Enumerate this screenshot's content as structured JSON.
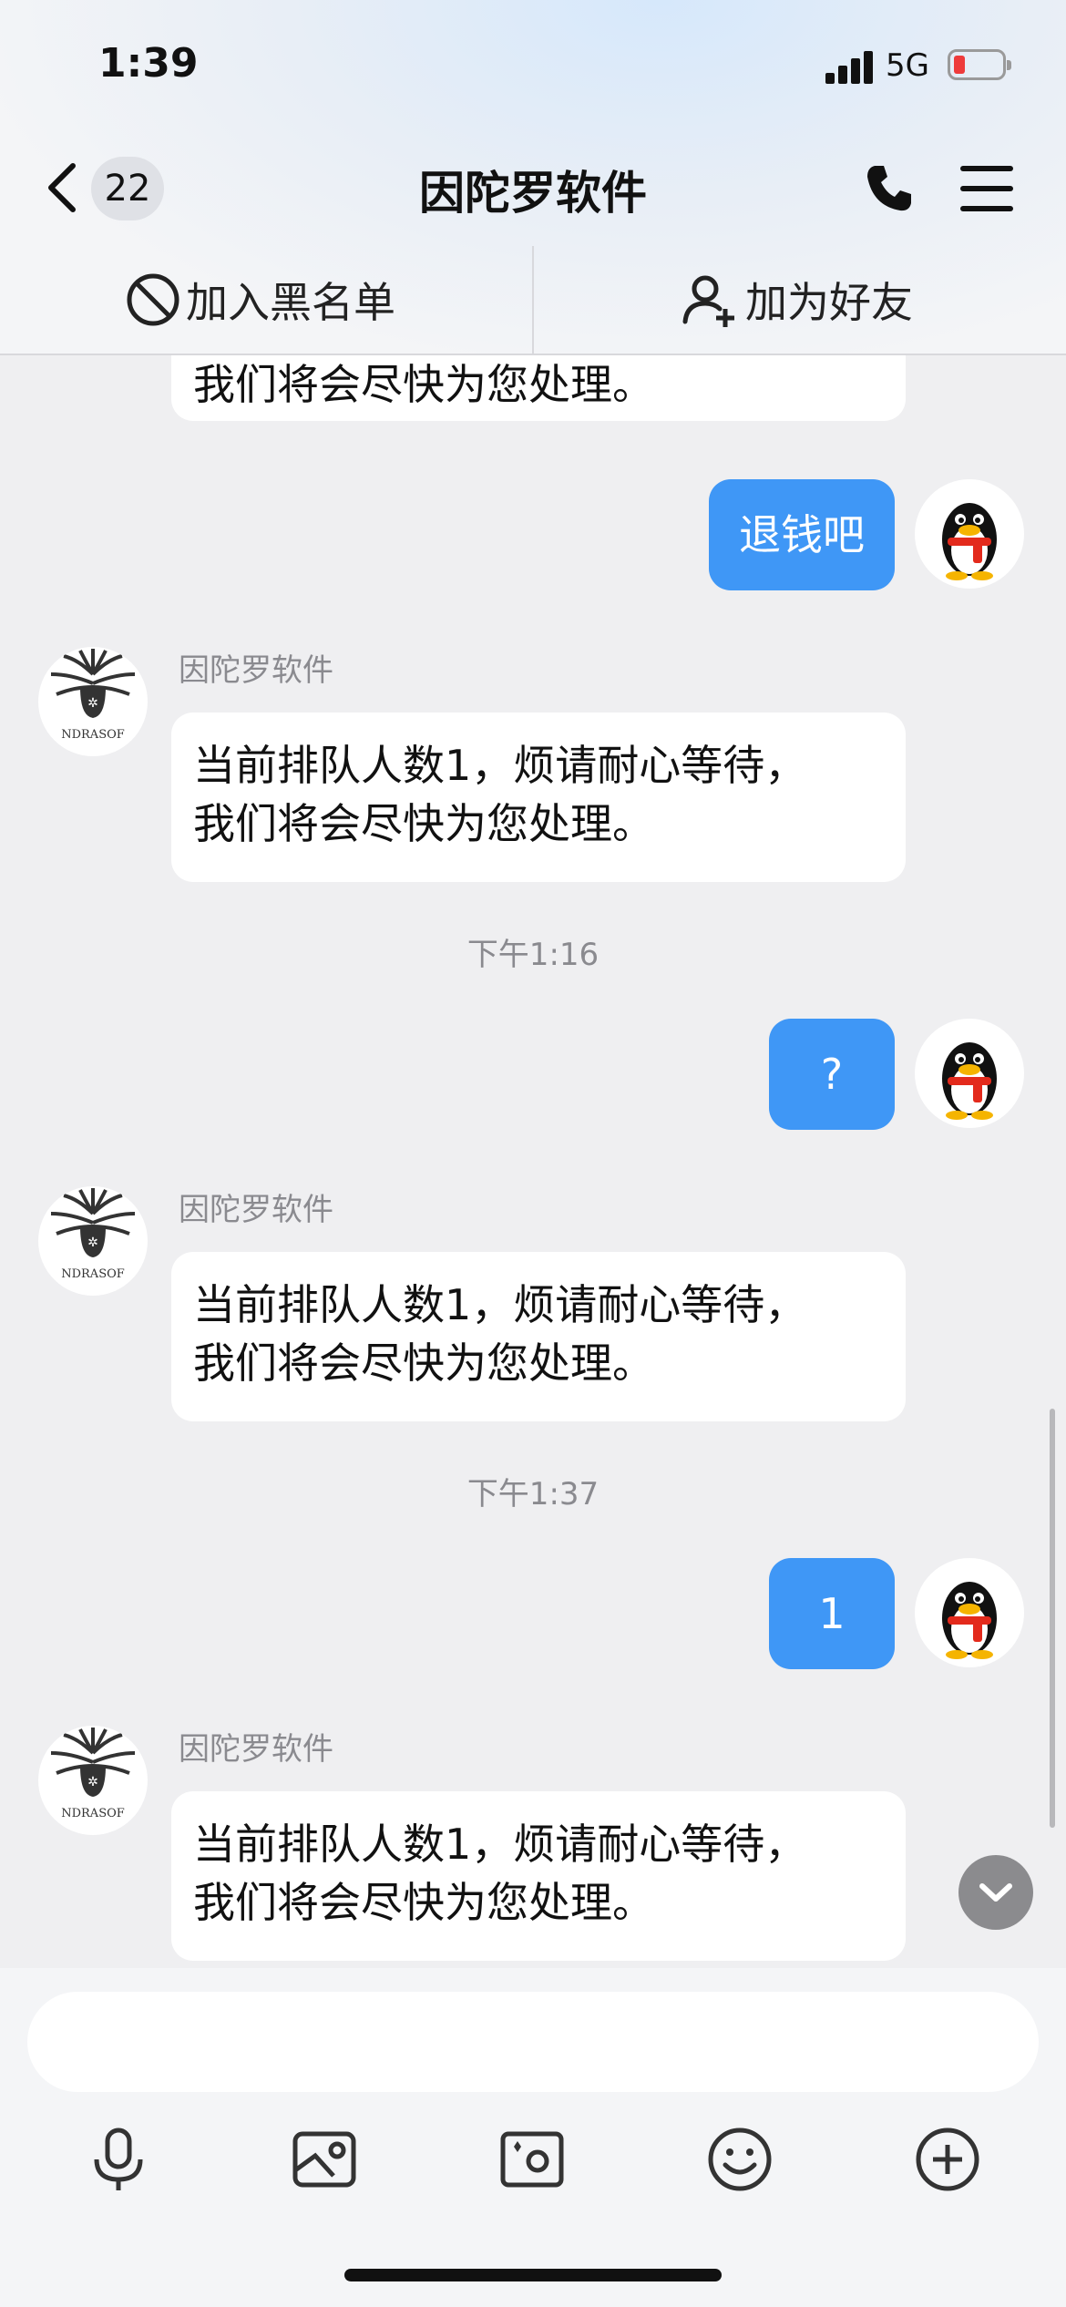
{
  "status_bar": {
    "time": "1:39",
    "network": "5G"
  },
  "header": {
    "unread_count": "22",
    "title": "因陀罗软件"
  },
  "actions": {
    "block_label": "加入黑名单",
    "add_friend_label": "加为好友"
  },
  "messages": [
    {
      "dir": "in",
      "text": "我们将会尽快为您处理。"
    },
    {
      "dir": "out",
      "text": "退钱吧"
    },
    {
      "dir": "in",
      "sender": "因陀罗软件",
      "line1": "当前排队人数1，烦请耐心等待，",
      "line2": "我们将会尽快为您处理。"
    },
    {
      "dir": "out",
      "text": "?"
    },
    {
      "dir": "in",
      "sender": "因陀罗软件",
      "line1": "当前排队人数1，烦请耐心等待，",
      "line2": "我们将会尽快为您处理。"
    },
    {
      "dir": "out",
      "text": "1"
    },
    {
      "dir": "in",
      "sender": "因陀罗软件",
      "line1": "当前排队人数1，烦请耐心等待，",
      "line2": "我们将会尽快为您处理。"
    }
  ],
  "timestamps": [
    "下午1:16",
    "下午1:37"
  ],
  "avatar_logo_text": "NDRASOF",
  "composer": {
    "placeholder": ""
  },
  "colors": {
    "outgoing_bubble": "#3f97f6",
    "incoming_bubble": "#ffffff",
    "background": "#efeff1"
  }
}
